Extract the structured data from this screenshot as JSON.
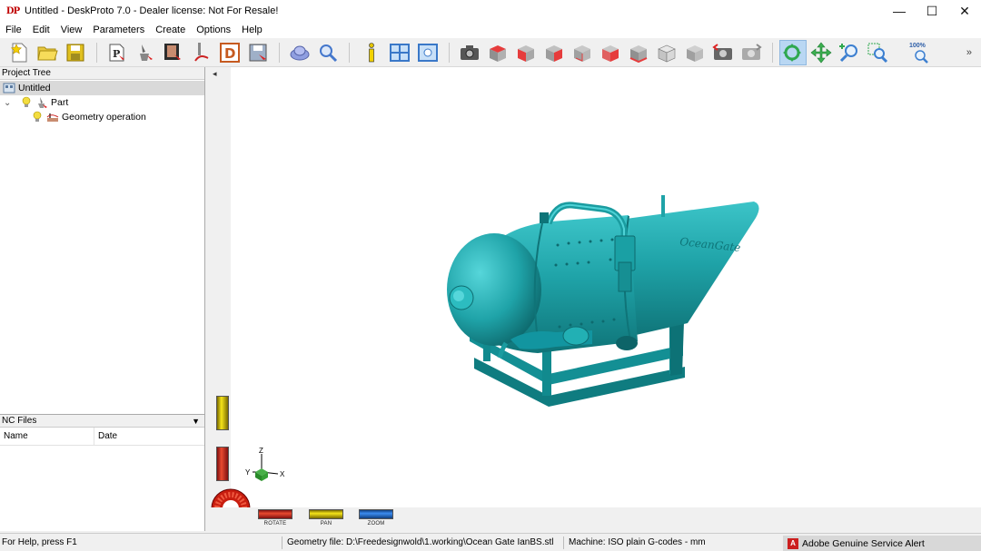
{
  "window": {
    "logo": "DP",
    "title": "Untitled - DeskProto 7.0 - Dealer license: Not For Resale!",
    "minimize": "—",
    "maximize": "☐",
    "close": "✕"
  },
  "menu": [
    "File",
    "Edit",
    "View",
    "Parameters",
    "Create",
    "Options",
    "Help"
  ],
  "toolbar": {
    "zoom_label": "100%",
    "more": "»"
  },
  "project_tree": {
    "header": "Project Tree",
    "root": "Untitled",
    "part": "Part",
    "operation": "Geometry operation",
    "collapse": "⌄"
  },
  "nc_files": {
    "header": "NC Files",
    "dropdown": "▼",
    "col_name": "Name",
    "col_date": "Date"
  },
  "viewport": {
    "collapse_arrow": "◂",
    "model_color": "#1fa3a8",
    "model_text": "OceanGate",
    "axis_z": "Z",
    "axis_y": "Y",
    "axis_x": "X",
    "rotate_label": "ROTATE",
    "pan_label": "PAN",
    "zoom_label": "ZOOM"
  },
  "status": {
    "help": "For Help, press F1",
    "geometry": "Geometry file: D:\\Freedesignwold\\1.working\\Ocean Gate IanBS.stl",
    "machine": "Machine: ISO plain G-codes - mm",
    "adobe_logo": "A",
    "adobe": "Adobe Genuine Service Alert"
  }
}
